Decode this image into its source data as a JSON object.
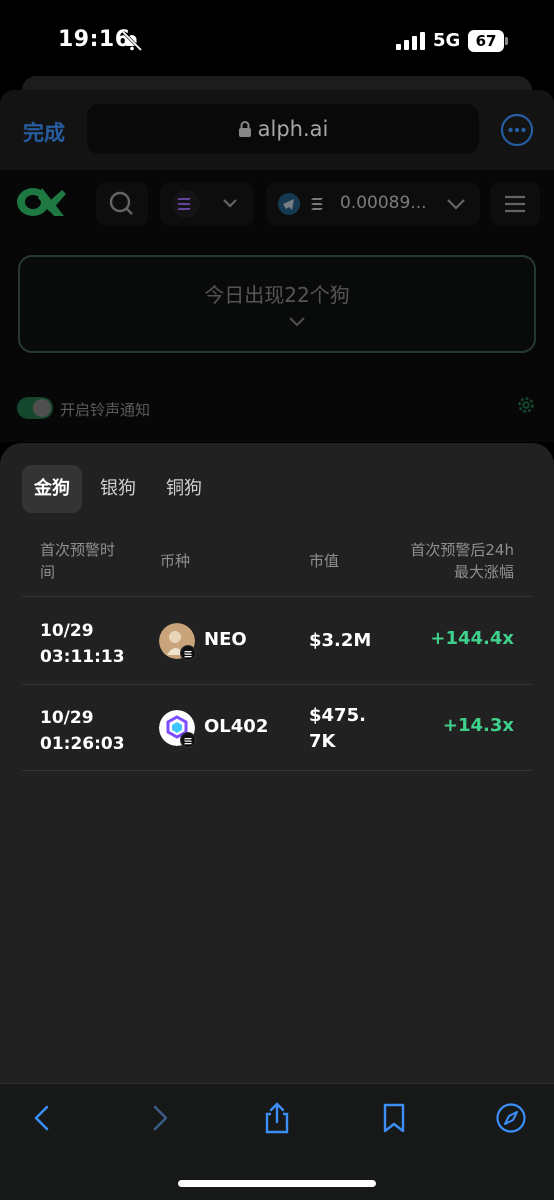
{
  "status_bar": {
    "time": "19:16",
    "network": "5G",
    "battery": "67"
  },
  "browser": {
    "done_label": "完成",
    "url": "alph.ai"
  },
  "page": {
    "wallet_amount": "0.00089...",
    "alert_text": "今日出现22个狗",
    "notify_label": "开启铃声通知",
    "toggle_on": true
  },
  "sheet": {
    "tabs": [
      {
        "label": "金狗",
        "active": true
      },
      {
        "label": "银狗",
        "active": false
      },
      {
        "label": "铜狗",
        "active": false
      }
    ],
    "headers": {
      "time_line1": "首次预警时",
      "time_line2": "间",
      "coin": "币种",
      "market_cap": "市值",
      "max_gain_line1": "首次预警后24h",
      "max_gain_line2": "最大涨幅"
    },
    "rows": [
      {
        "date": "10/29",
        "time": "03:11:13",
        "coin": "NEO",
        "cap_line1": "$3.2M",
        "cap_line2": "",
        "gain": "+144.4x"
      },
      {
        "date": "10/29",
        "time": "01:26:03",
        "coin": "OL402",
        "cap_line1": "$475.",
        "cap_line2": "7K",
        "gain": "+14.3x"
      }
    ]
  },
  "colors": {
    "accent_blue": "#3b8ff6",
    "gain_green": "#3fd08b",
    "brand_green": "#2fb865"
  },
  "toolbar": {
    "icons": [
      "back-icon",
      "forward-icon",
      "share-icon",
      "bookmarks-icon",
      "safari-compass-icon"
    ]
  }
}
